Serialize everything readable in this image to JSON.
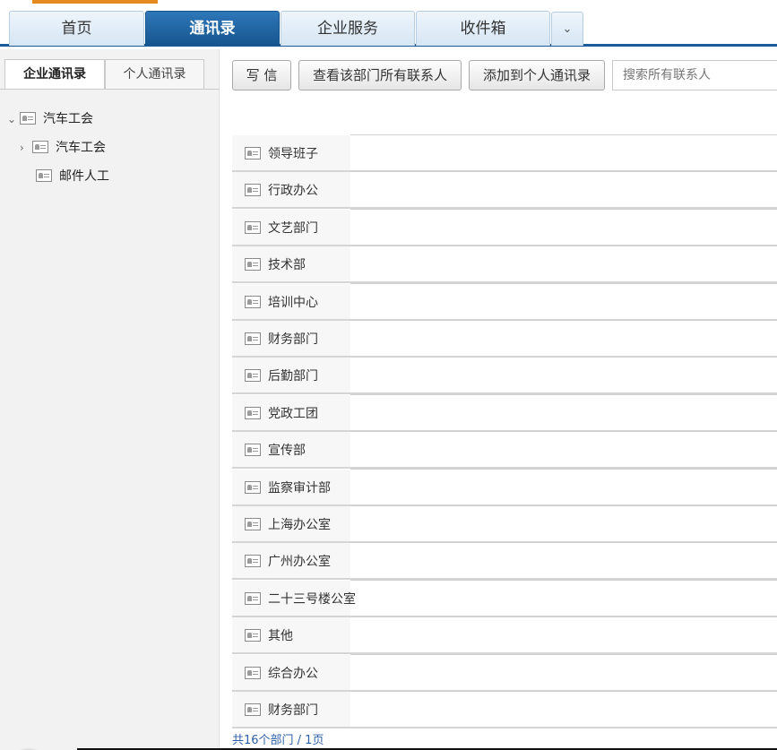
{
  "nav": {
    "tabs": [
      {
        "label": "首页"
      },
      {
        "label": "通讯录"
      },
      {
        "label": "企业服务"
      },
      {
        "label": "收件箱"
      }
    ],
    "more_icon": "chevron-down-icon",
    "accent": "#1a5c99"
  },
  "sidebar": {
    "tabs": [
      {
        "label": "企业通讯录"
      },
      {
        "label": "个人通讯录"
      }
    ],
    "tree": [
      {
        "label": "汽车工会",
        "expanded": true
      },
      {
        "label": "汽车工会",
        "expanded": false
      },
      {
        "label": "邮件人工"
      }
    ]
  },
  "toolbar": {
    "write_label": "写 信",
    "view_all_label": "查看该部门所有联系人",
    "add_personal_label": "添加到个人通讯录",
    "search_placeholder": "搜索所有联系人"
  },
  "list": {
    "rows": [
      {
        "name": "领导班子"
      },
      {
        "name": "行政办公"
      },
      {
        "name": "文艺部门"
      },
      {
        "name": "技术部"
      },
      {
        "name": "培训中心"
      },
      {
        "name": "财务部门"
      },
      {
        "name": "后勤部门"
      },
      {
        "name": "党政工团"
      },
      {
        "name": "宣传部"
      },
      {
        "name": "监察审计部"
      },
      {
        "name": "上海办公室"
      },
      {
        "name": "广州办公室"
      },
      {
        "name": "二十三号楼公室"
      },
      {
        "name": "其他"
      },
      {
        "name": "综合办公"
      },
      {
        "name": "财务部门"
      }
    ]
  },
  "pager": {
    "text": "共16个部门 / 1页"
  }
}
